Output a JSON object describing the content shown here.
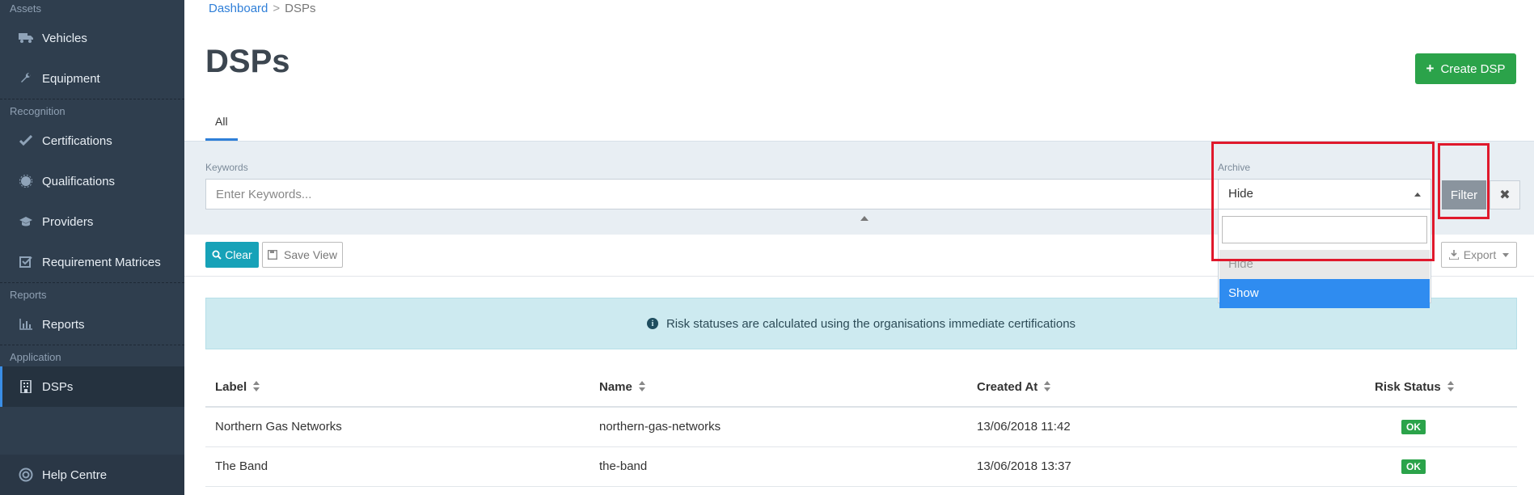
{
  "sidebar": {
    "sections": [
      {
        "title": "Assets",
        "items": [
          {
            "label": "Vehicles",
            "icon": "truck-icon"
          },
          {
            "label": "Equipment",
            "icon": "wrench-icon"
          }
        ]
      },
      {
        "title": "Recognition",
        "items": [
          {
            "label": "Certifications",
            "icon": "check-icon"
          },
          {
            "label": "Qualifications",
            "icon": "badge-icon"
          },
          {
            "label": "Providers",
            "icon": "graduation-cap-icon"
          },
          {
            "label": "Requirement Matrices",
            "icon": "checkbox-icon"
          }
        ]
      },
      {
        "title": "Reports",
        "items": [
          {
            "label": "Reports",
            "icon": "bar-chart-icon"
          }
        ]
      },
      {
        "title": "Application",
        "items": [
          {
            "label": "DSPs",
            "icon": "building-icon",
            "active": true
          }
        ]
      }
    ],
    "help": {
      "label": "Help Centre",
      "icon": "lifebuoy-icon"
    }
  },
  "breadcrumb": {
    "parent": "Dashboard",
    "separator": ">",
    "current": "DSPs"
  },
  "page": {
    "title": "DSPs",
    "create_button": "Create DSP"
  },
  "tabs": [
    {
      "label": "All",
      "active": true
    }
  ],
  "filters": {
    "keywords_label": "Keywords",
    "keywords_placeholder": "Enter Keywords...",
    "archive_label": "Archive",
    "archive_value": "Hide",
    "archive_options": [
      "Hide",
      "Show"
    ],
    "archive_highlighted": "Show",
    "filter_button": "Filter",
    "clear_icon": "close-icon"
  },
  "toolbar": {
    "clear": "Clear",
    "save_view": "Save View",
    "export": "Export"
  },
  "alert": {
    "text": "Risk statuses are calculated using the organisations immediate certifications",
    "icon": "info-icon"
  },
  "table": {
    "columns": [
      "Label",
      "Name",
      "Created At",
      "Risk Status"
    ],
    "rows": [
      {
        "label": "Northern Gas Networks",
        "name": "northern-gas-networks",
        "created_at": "13/06/2018 11:42",
        "risk_status": "OK"
      },
      {
        "label": "The Band",
        "name": "the-band",
        "created_at": "13/06/2018 13:37",
        "risk_status": "OK"
      }
    ]
  },
  "colors": {
    "sidebar_bg": "#2f3e4e",
    "accent_blue": "#2f7fd8",
    "create_green": "#2ba34a",
    "info_bg": "#cdeaf0",
    "highlight_red": "#e0192c",
    "selected_option": "#2f8cf0"
  }
}
